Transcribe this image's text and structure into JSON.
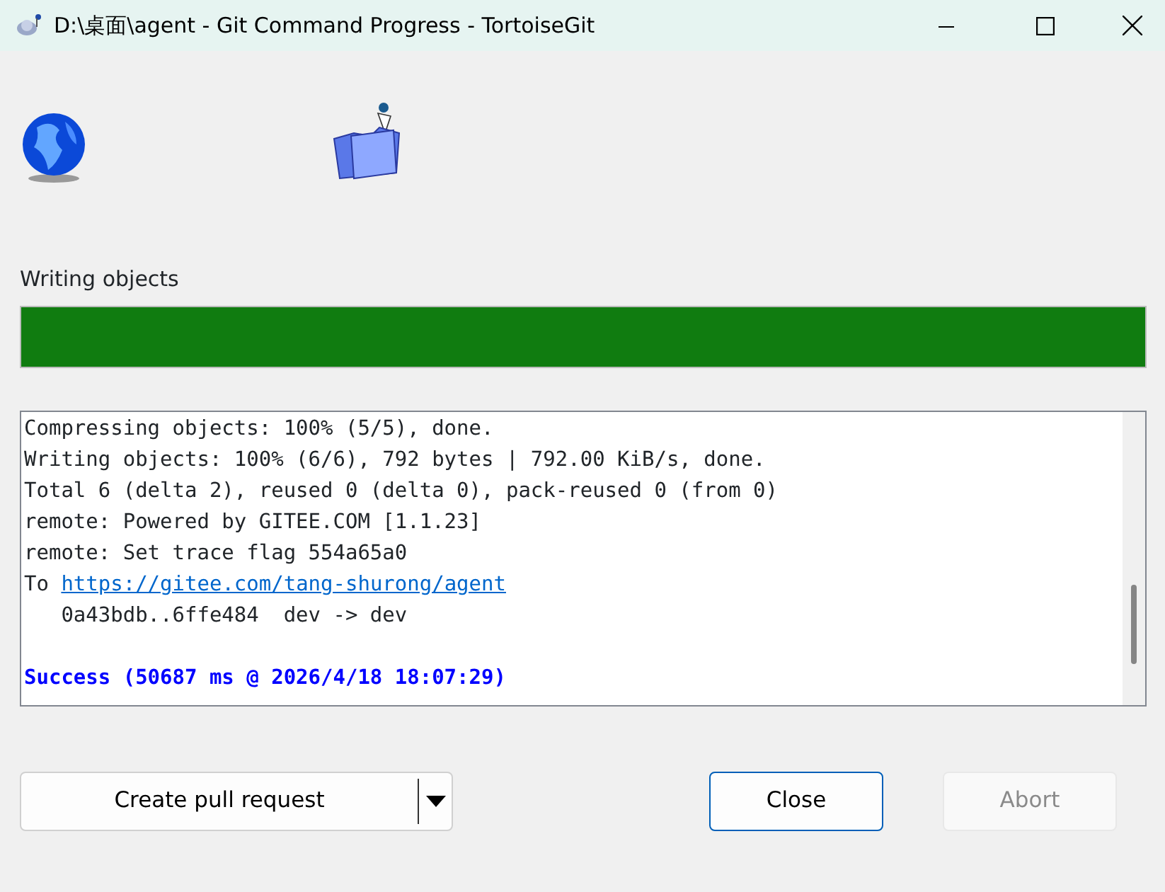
{
  "window": {
    "title": "D:\\桌面\\agent - Git Command Progress - TortoiseGit"
  },
  "status": {
    "label": "Writing objects",
    "level": 1
  },
  "log": [
    {
      "kind": "text",
      "text": "Compressing objects: 100% (5/5), done."
    },
    {
      "kind": "text",
      "text": "Writing objects: 100% (6/6), 792 bytes | 792.00 KiB/s, done."
    },
    {
      "kind": "text",
      "text": "Total 6 (delta 2), reused 0 (delta 0), pack-reused 0 (from 0)"
    },
    {
      "kind": "text",
      "text": "remote: Powered by GITEE.COM [1.1.23]"
    },
    {
      "kind": "text",
      "text": "remote: Set trace flag 554a65a0"
    },
    {
      "kind": "link",
      "text": "To ",
      "link": "https://gitee.com/tang-shurong/agent"
    },
    {
      "kind": "text",
      "text": "   0a43bdb..6ffe484  dev -> dev"
    },
    {
      "kind": "spacer"
    },
    {
      "kind": "success",
      "text": "Success (50687 ms @ 2026/4/18 18:07:29)"
    }
  ],
  "buttons": [
    {
      "kind": "split",
      "label": "Create pull request",
      "default": false,
      "disabled": false
    },
    {
      "kind": "plain",
      "label": "Close",
      "default": true,
      "disabled": false
    },
    {
      "kind": "plain",
      "label": "Abort",
      "default": false,
      "disabled": true
    }
  ]
}
